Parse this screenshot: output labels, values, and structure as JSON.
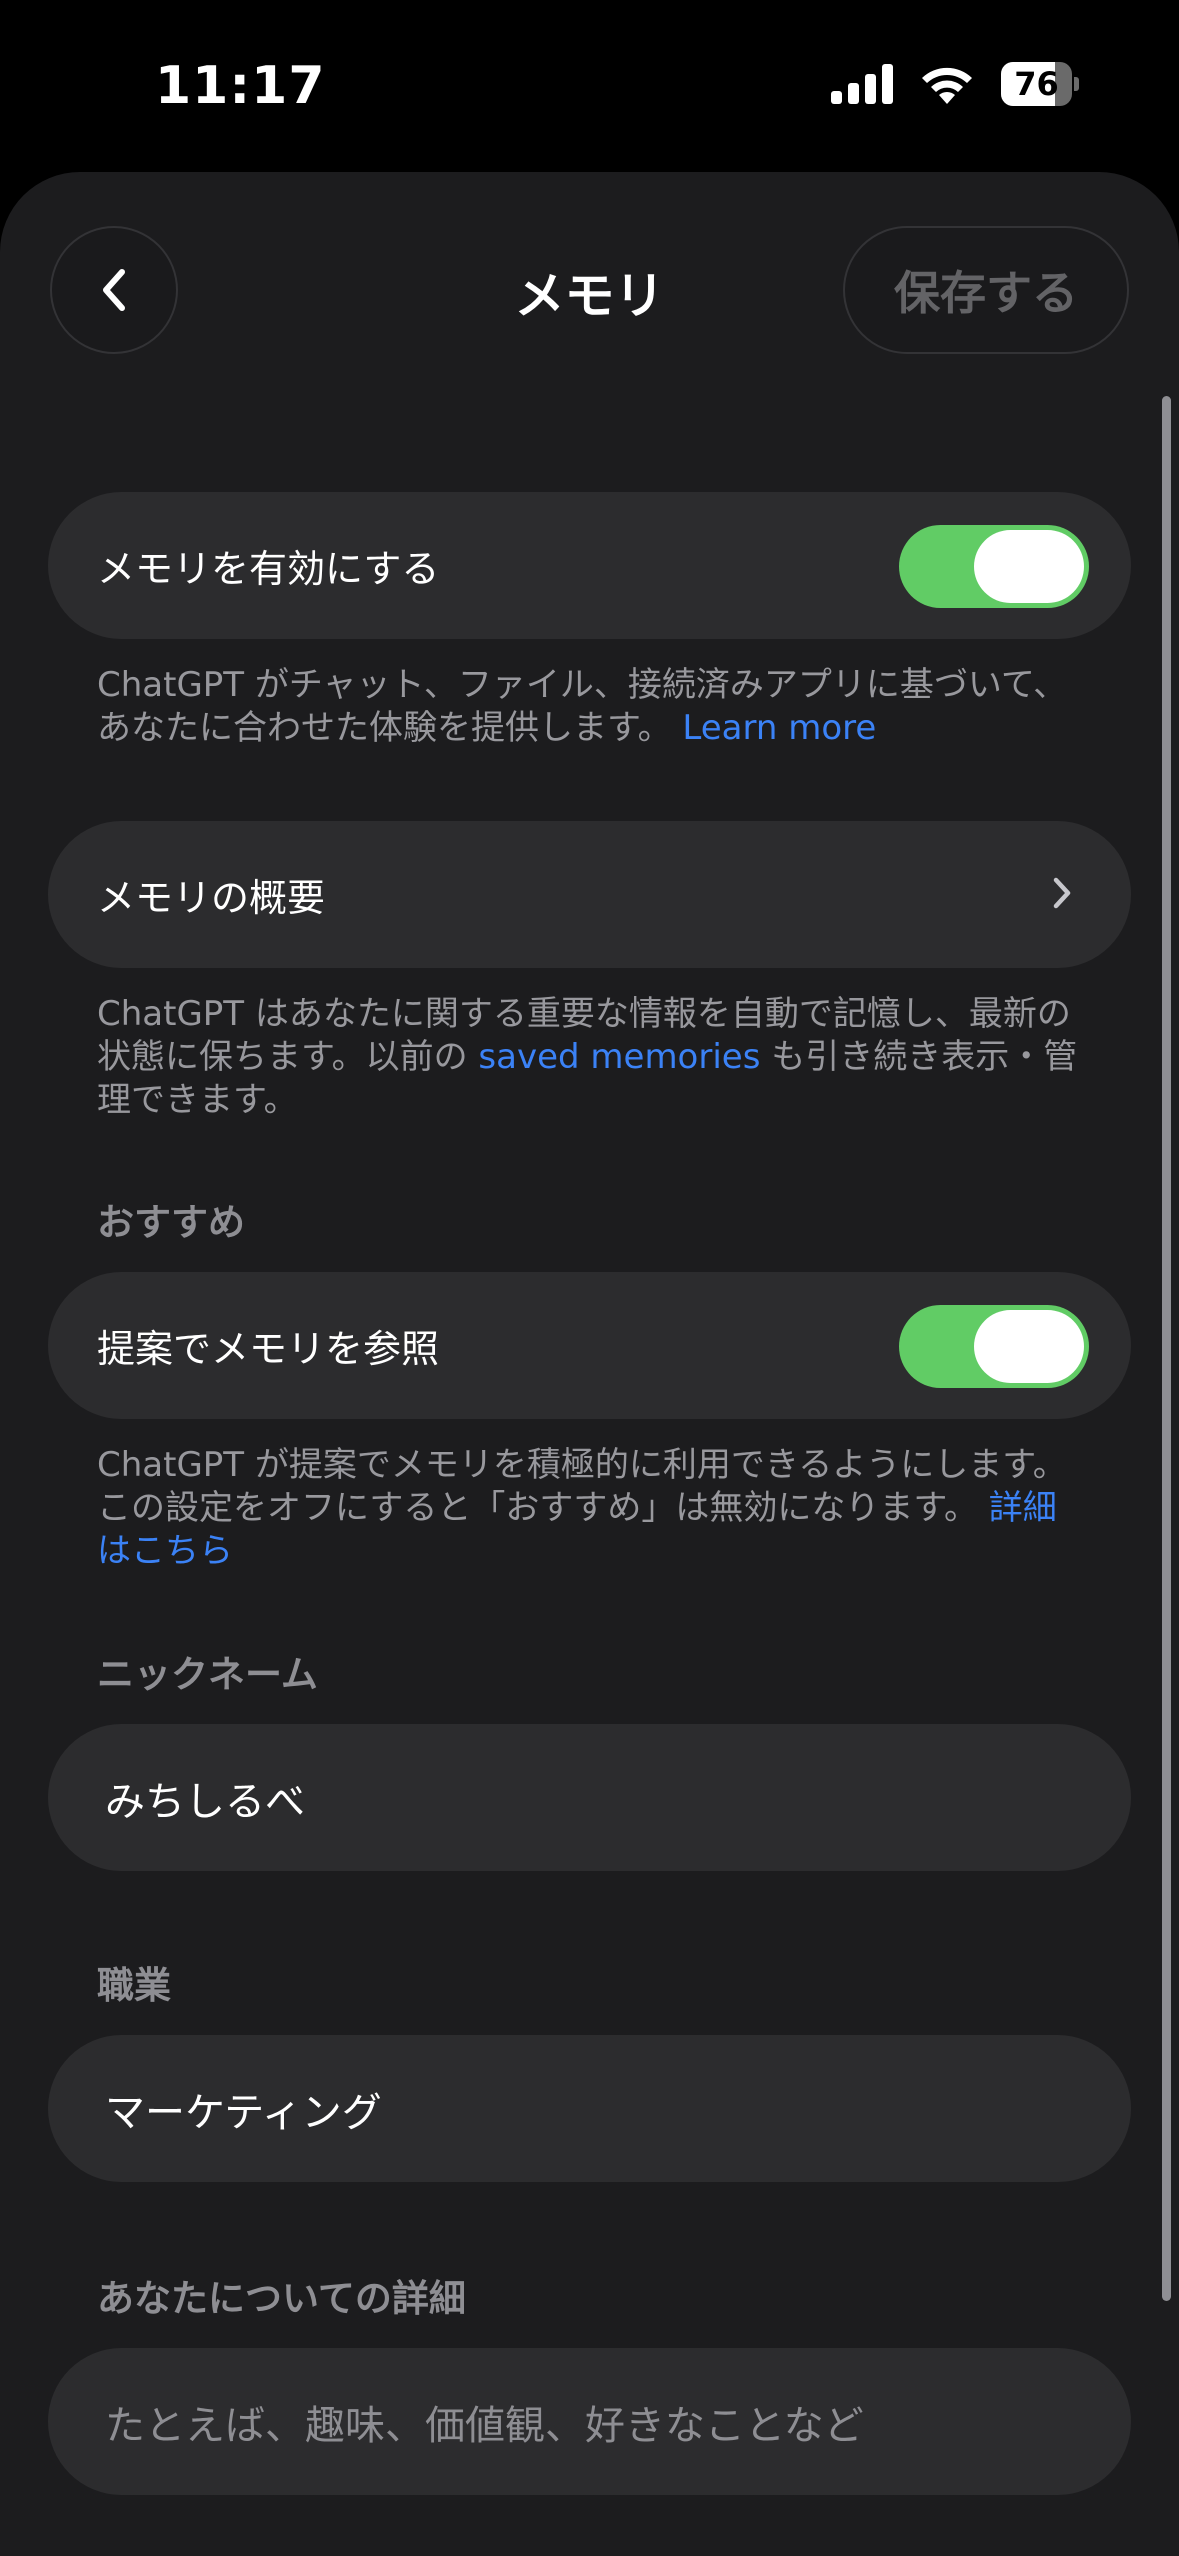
{
  "status_bar": {
    "time": "11:17",
    "battery": 76
  },
  "header": {
    "title": "メモリ",
    "save_label": "保存する"
  },
  "memory_toggle": {
    "label": "メモリを有効にする",
    "enabled": true,
    "description": "ChatGPT がチャット、ファイル、接続済みアプリに基づいて、あなたに合わせた体験を提供します。",
    "link": "Learn more"
  },
  "memory_overview": {
    "label": "メモリの概要",
    "description_before": "ChatGPT はあなたに関する重要な情報を自動で記憶し、最新の状態に保ちます。以前の ",
    "link": "saved memories",
    "description_after": " も引き続き表示・管理できます。"
  },
  "recommendations": {
    "section_label": "おすすめ",
    "toggle_label": "提案でメモリを参照",
    "enabled": true,
    "description": "ChatGPT が提案でメモリを積極的に利用できるようにします。この設定をオフにすると「おすすめ」は無効になります。",
    "link": "詳細はこちら"
  },
  "nickname": {
    "section_label": "ニックネーム",
    "value": "みちしるべ"
  },
  "occupation": {
    "section_label": "職業",
    "value": "マーケティング"
  },
  "about_you": {
    "section_label": "あなたについての詳細",
    "placeholder": "たとえば、趣味、価値観、好きなことなど"
  },
  "colors": {
    "toggle_on": "#61cc65",
    "link": "#3b82f6",
    "background": "#1c1c1e",
    "card": "#2c2c2e"
  },
  "icons": [
    "back-chevron-icon",
    "chevron-right-icon",
    "signal-icon",
    "wifi-icon",
    "battery-icon"
  ]
}
